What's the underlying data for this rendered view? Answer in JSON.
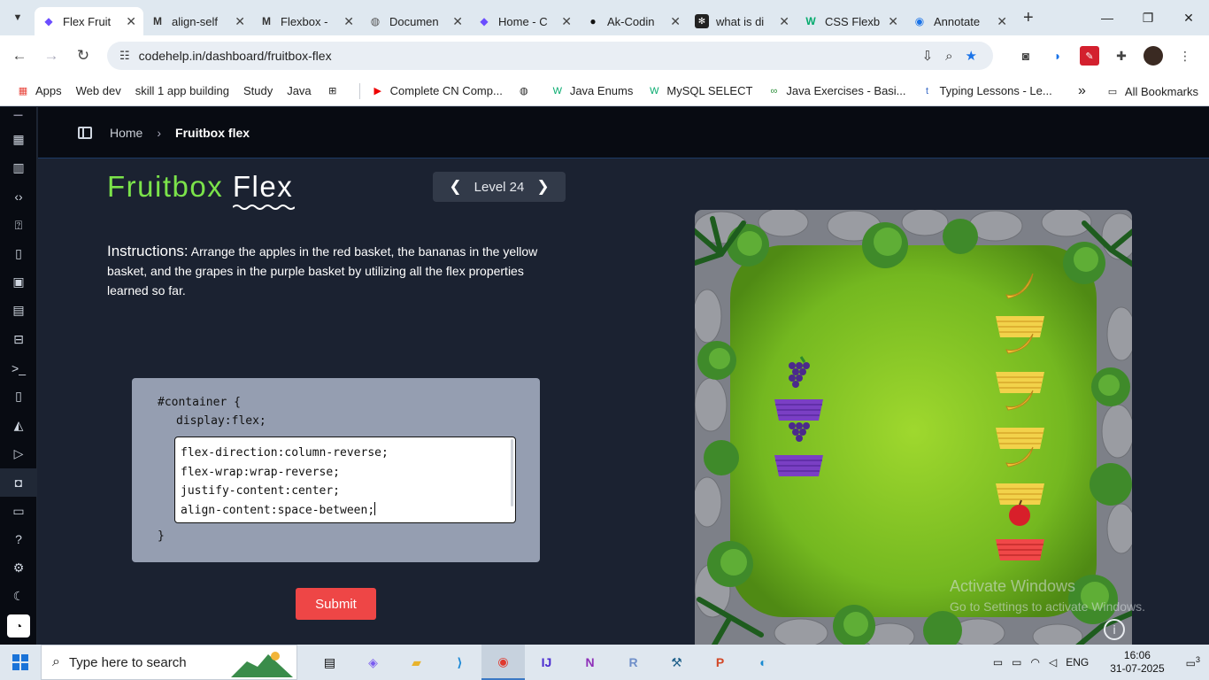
{
  "browser": {
    "tabs": [
      {
        "title": "Flex Fruit",
        "icon": "codehelp-icon",
        "active": true
      },
      {
        "title": "align-self",
        "icon": "mdn-icon"
      },
      {
        "title": "Flexbox -",
        "icon": "mdn-icon"
      },
      {
        "title": "Documen",
        "icon": "globe-icon"
      },
      {
        "title": "Home - C",
        "icon": "codehelp-icon"
      },
      {
        "title": "Ak-Codin",
        "icon": "github-icon"
      },
      {
        "title": "what is di",
        "icon": "chatgpt-icon"
      },
      {
        "title": "CSS Flexb",
        "icon": "w3schools-icon"
      },
      {
        "title": "Annotate",
        "icon": "annotate-icon"
      }
    ],
    "url": "codehelp.in/dashboard/fruitbox-flex",
    "bookmarks": [
      {
        "label": "Apps",
        "icon": "apps-grid-icon"
      },
      {
        "label": "Web dev",
        "icon": ""
      },
      {
        "label": "skill 1 app building",
        "icon": ""
      },
      {
        "label": "Study",
        "icon": ""
      },
      {
        "label": "Java",
        "icon": ""
      },
      {
        "label": "",
        "icon": "tile-grid-icon"
      },
      {
        "label": "Complete CN Comp...",
        "icon": "youtube-icon"
      },
      {
        "label": "",
        "icon": "globe-icon"
      },
      {
        "label": "Java Enums",
        "icon": "w3schools-icon"
      },
      {
        "label": "MySQL SELECT",
        "icon": "w3schools-icon"
      },
      {
        "label": "Java Exercises - Basi...",
        "icon": "exercises-icon"
      },
      {
        "label": "Typing Lessons - Le...",
        "icon": "typing-icon"
      }
    ],
    "all_bookmarks": "All Bookmarks"
  },
  "page": {
    "breadcrumb": {
      "home": "Home",
      "current": "Fruitbox flex"
    },
    "title_green": "Fruitbox",
    "title_white": "Flex",
    "level_label": "Level 24",
    "instructions_label": "Instructions:",
    "instructions_text": "Arrange the apples in the red basket, the bananas in the yellow basket, and the grapes in the purple basket by utilizing all the flex properties learned so far.",
    "code": {
      "selector_line": "#container {",
      "fixed_line": "display:flex;",
      "closing": "}",
      "editor_lines": [
        "flex-direction:column-reverse;",
        "flex-wrap:wrap-reverse;",
        "justify-content:center;",
        "align-content:space-between;"
      ]
    },
    "submit_label": "Submit"
  },
  "sidebar_icons": [
    "dashboard-icon",
    "library-icon",
    "code-icon",
    "quiz-icon",
    "clipboard-icon",
    "briefcase-icon",
    "news-icon",
    "book-icon",
    "terminal-icon",
    "notes-icon",
    "graduation-icon",
    "video-icon",
    "gamepad-icon",
    "chat-icon",
    "help-icon",
    "settings-icon",
    "theme-icon",
    "user-icon"
  ],
  "watermark": {
    "title": "Activate Windows",
    "subtitle": "Go to Settings to activate Windows."
  },
  "taskbar": {
    "search_placeholder": "Type here to search",
    "time": "16:06",
    "date": "31-07-2025",
    "language": "ENG",
    "notification_count": "3"
  },
  "colors": {
    "accent_green": "#7be34a",
    "submit_red": "#ee4646",
    "page_bg": "#1b2231",
    "grass": "#6fb522"
  }
}
